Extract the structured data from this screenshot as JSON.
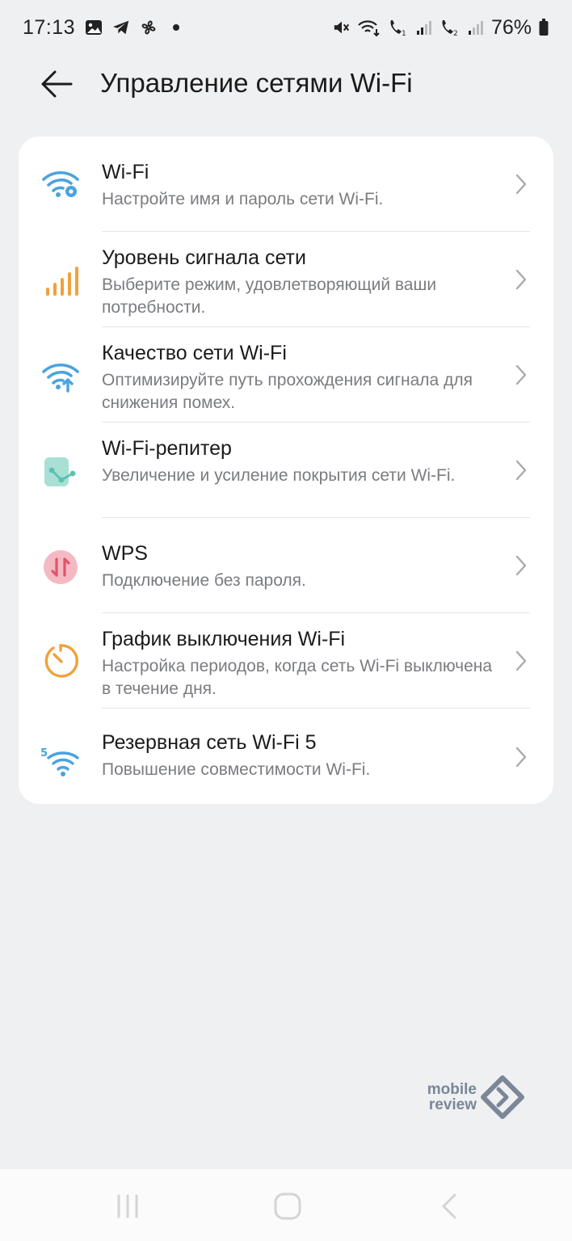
{
  "status_bar": {
    "time": "17:13",
    "battery_percent": "76%",
    "icons_left": [
      "gallery-icon",
      "telegram-icon",
      "fan-icon",
      "dot-icon"
    ],
    "icons_right": [
      "mute-icon",
      "wifi-calling-icon",
      "volte-sim1-icon",
      "signal-sim1-icon",
      "volte-sim2-icon",
      "signal-sim2-icon",
      "battery-icon"
    ]
  },
  "header": {
    "title": "Управление сетями Wi-Fi"
  },
  "menu": {
    "items": [
      {
        "title": "Wi-Fi",
        "subtitle": "Настройте имя и пароль сети Wi-Fi.",
        "icon": "wifi-settings-icon",
        "color": "#4aa3df"
      },
      {
        "title": "Уровень сигнала сети",
        "subtitle": "Выберите режим, удовлетворяющий ваши потребности.",
        "icon": "signal-bars-icon",
        "color": "#f0a23a"
      },
      {
        "title": "Качество сети Wi-Fi",
        "subtitle": "Оптимизируйте путь прохождения сигнала для снижения помех.",
        "icon": "wifi-quality-icon",
        "color": "#4aa3df"
      },
      {
        "title": "Wi-Fi-репитер",
        "subtitle": "Увеличение и усиление покрытия сети Wi-Fi.",
        "icon": "repeater-icon",
        "color": "#5cc2b0"
      },
      {
        "title": "WPS",
        "subtitle": "Подключение без пароля.",
        "icon": "wps-icon",
        "color": "#e0546a"
      },
      {
        "title": "График выключения Wi-Fi",
        "subtitle": "Настройка периодов, когда сеть Wi-Fi выключена в течение дня.",
        "icon": "timer-icon",
        "color": "#f0a23a"
      },
      {
        "title": "Резервная сеть Wi-Fi 5",
        "subtitle": "Повышение совместимости Wi-Fi.",
        "icon": "wifi5-icon",
        "color": "#4aa3df"
      }
    ]
  },
  "watermark": {
    "line1": "mobile",
    "line2": "review"
  },
  "nav_bar": {
    "buttons": [
      "recents-icon",
      "home-icon",
      "back-icon"
    ]
  }
}
